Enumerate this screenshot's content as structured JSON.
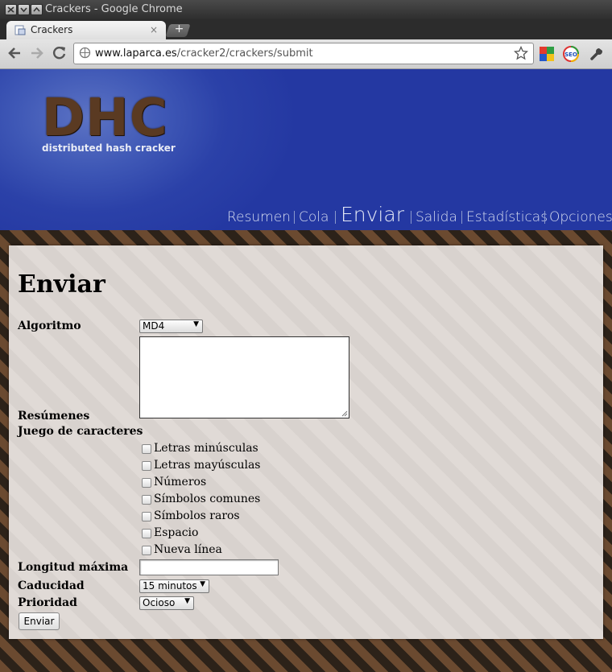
{
  "window": {
    "title": "Crackers - Google Chrome"
  },
  "tab": {
    "title": "Crackers",
    "close": "×",
    "new_tab": "+"
  },
  "toolbar": {
    "url_host": "www.laparca.es",
    "url_path": "/cracker2/crackers/submit",
    "extensions": [
      "colored-squares-extension-icon",
      "seo-extension-icon",
      "wrench-icon"
    ],
    "seo_label": "SEO"
  },
  "header": {
    "logo": "DHC",
    "subtitle": "distributed hash cracker",
    "nav": [
      {
        "label": "Resumen",
        "active": false
      },
      {
        "label": "Cola",
        "active": false
      },
      {
        "label": "Enviar",
        "active": true
      },
      {
        "label": "Salida",
        "active": false
      },
      {
        "label": "Estadísticas",
        "active": false
      },
      {
        "label": "Opciones",
        "active": false
      }
    ]
  },
  "form": {
    "heading": "Enviar",
    "algorithm": {
      "label": "Algoritmo",
      "value": "MD4"
    },
    "hashes": {
      "label": "Resúmenes",
      "value": ""
    },
    "charset": {
      "label": "Juego de caracteres",
      "options": [
        {
          "label": "Letras minúsculas",
          "checked": false
        },
        {
          "label": "Letras mayúsculas",
          "checked": false
        },
        {
          "label": "Números",
          "checked": false
        },
        {
          "label": "Símbolos comunes",
          "checked": false
        },
        {
          "label": "Símbolos raros",
          "checked": false
        },
        {
          "label": "Espacio",
          "checked": false
        },
        {
          "label": "Nueva línea",
          "checked": false
        }
      ]
    },
    "max_length": {
      "label": "Longitud máxima",
      "value": ""
    },
    "expiry": {
      "label": "Caducidad",
      "value": "15 minutos"
    },
    "priority": {
      "label": "Prioridad",
      "value": "Ocioso"
    },
    "submit": {
      "label": "Enviar"
    }
  },
  "colors": {
    "header_blue": "#2b41a8",
    "nav_text": "#d6dcf0",
    "panel_bg": "#e0dad6",
    "stripe_brown": "#6b4a30",
    "stripe_dark": "#2c2219"
  }
}
